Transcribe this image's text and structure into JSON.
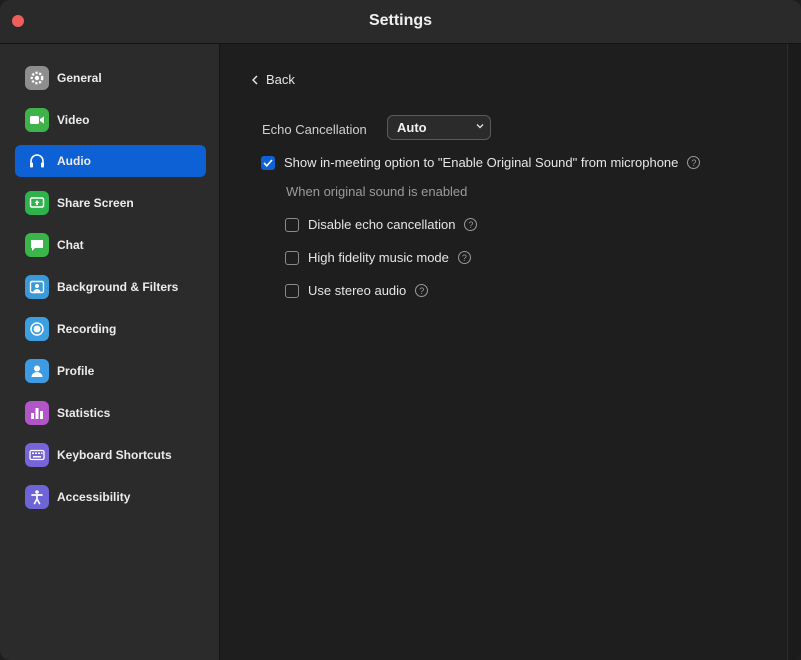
{
  "window": {
    "title": "Settings"
  },
  "sidebar": {
    "items": [
      {
        "label": "General",
        "icon": "gear-icon",
        "color": "#8e8e8e",
        "active": false
      },
      {
        "label": "Video",
        "icon": "video-camera-icon",
        "color": "#3fb24a",
        "active": false
      },
      {
        "label": "Audio",
        "icon": "headphones-icon",
        "color": "#0e61d4",
        "active": true
      },
      {
        "label": "Share Screen",
        "icon": "share-screen-icon",
        "color": "#2eb24b",
        "active": false
      },
      {
        "label": "Chat",
        "icon": "chat-bubble-icon",
        "color": "#3bb44a",
        "active": false
      },
      {
        "label": "Background & Filters",
        "icon": "person-background-icon",
        "color": "#3a9ad9",
        "active": false
      },
      {
        "label": "Recording",
        "icon": "record-icon",
        "color": "#3c9fe0",
        "active": false
      },
      {
        "label": "Profile",
        "icon": "profile-icon",
        "color": "#3d9be3",
        "active": false
      },
      {
        "label": "Statistics",
        "icon": "bar-chart-icon",
        "color": "#b155c9",
        "active": false
      },
      {
        "label": "Keyboard Shortcuts",
        "icon": "keyboard-icon",
        "color": "#7764d8",
        "active": false
      },
      {
        "label": "Accessibility",
        "icon": "accessibility-icon",
        "color": "#6d64d6",
        "active": false
      }
    ]
  },
  "main": {
    "back_label": "Back",
    "echo_label": "Echo Cancellation",
    "echo_value": "Auto",
    "original_sound": {
      "label": "Show in-meeting option to \"Enable Original Sound\" from microphone",
      "checked": true
    },
    "sub_heading": "When original sound is enabled",
    "options": [
      {
        "label": "Disable echo cancellation",
        "checked": false
      },
      {
        "label": "High fidelity music mode",
        "checked": false
      },
      {
        "label": "Use stereo audio",
        "checked": false
      }
    ],
    "help_glyph": "?"
  },
  "colors": {
    "accent": "#0e61d4",
    "close": "#ec5f5a"
  }
}
